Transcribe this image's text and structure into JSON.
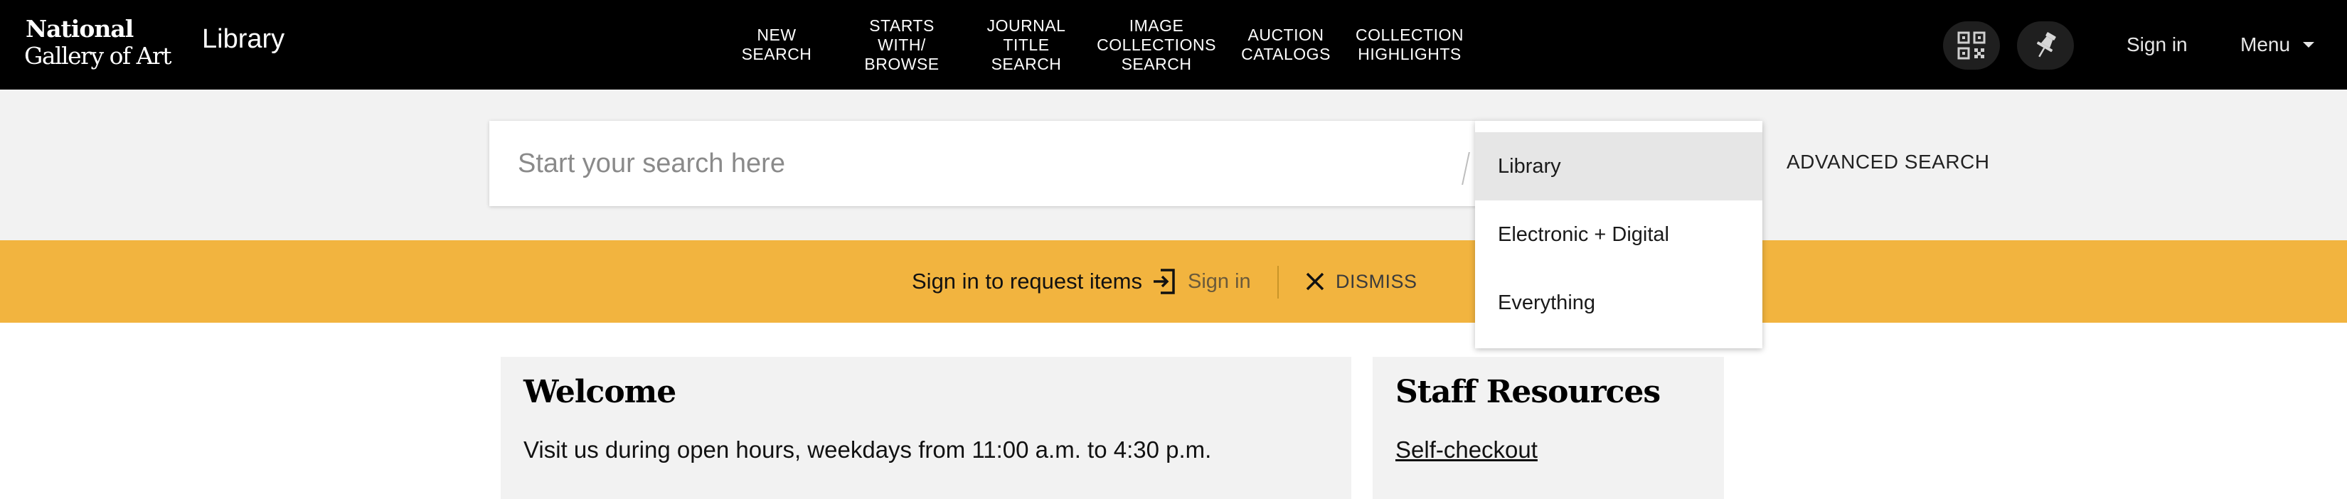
{
  "header": {
    "logo_line1": "National",
    "logo_line2": "Gallery of Art",
    "section_title": "Library",
    "nav": [
      {
        "label": "NEW\nSEARCH"
      },
      {
        "label": "STARTS\nWITH/\nBROWSE"
      },
      {
        "label": "JOURNAL\nTITLE\nSEARCH"
      },
      {
        "label": "IMAGE\nCOLLECTIONS\nSEARCH"
      },
      {
        "label": "AUCTION\nCATALOGS"
      },
      {
        "label": "COLLECTION\nHIGHLIGHTS"
      }
    ],
    "qr_icon": "qr-code-icon",
    "pin_icon": "pin-icon",
    "sign_in": "Sign in",
    "menu": "Menu",
    "menu_icon": "caret-down-icon"
  },
  "search": {
    "placeholder": "Start your search here",
    "value": "",
    "advanced_label": "ADVANCED SEARCH",
    "scope_options": [
      {
        "label": "Library",
        "selected": true
      },
      {
        "label": "Electronic + Digital",
        "selected": false
      },
      {
        "label": "Everything",
        "selected": false
      }
    ]
  },
  "banner": {
    "message": "Sign in to request items",
    "sign_in_label": "Sign in",
    "sign_in_icon": "sign-in-icon",
    "dismiss_label": "DISMISS",
    "dismiss_icon": "close-icon"
  },
  "welcome": {
    "title": "Welcome",
    "text": "Visit us during open hours, weekdays from 11:00 a.m. to 4:30 p.m."
  },
  "staff": {
    "title": "Staff Resources",
    "link": "Self-checkout"
  },
  "colors": {
    "header_bg": "#000000",
    "search_band_bg": "#f2f2f2",
    "banner_bg": "#f2b43f",
    "card_bg": "#f2f2f2"
  }
}
